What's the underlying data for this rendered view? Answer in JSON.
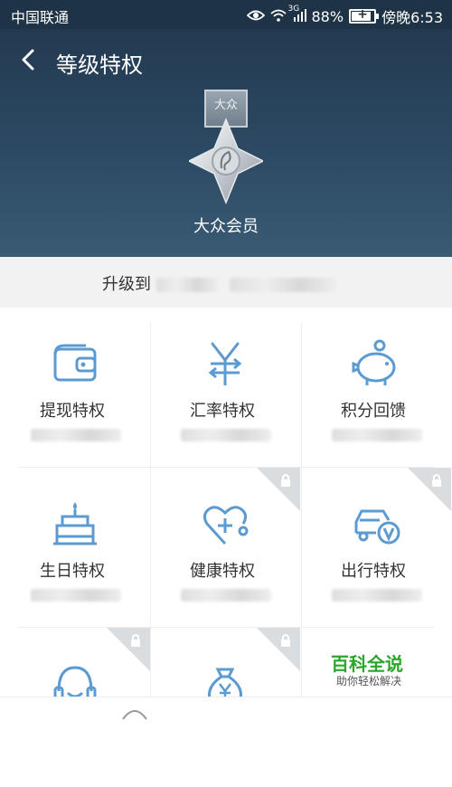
{
  "status_bar": {
    "carrier": "中国联通",
    "network": "3G",
    "battery_percent": "88%",
    "battery_level": 0.88,
    "time": "傍晚6:53"
  },
  "header": {
    "back_icon": "chevron-left-icon",
    "title": "等级特权",
    "medal_ribbon_text": "大众",
    "member_level": "大众会员"
  },
  "banner": {
    "text": "升级到"
  },
  "privileges": [
    {
      "label": "提现特权",
      "icon": "wallet-icon",
      "locked": false
    },
    {
      "label": "汇率特权",
      "icon": "yen-exchange-icon",
      "locked": false
    },
    {
      "label": "积分回馈",
      "icon": "piggy-bank-icon",
      "locked": false
    },
    {
      "label": "生日特权",
      "icon": "birthday-cake-icon",
      "locked": false
    },
    {
      "label": "健康特权",
      "icon": "stethoscope-icon",
      "locked": true
    },
    {
      "label": "出行特权",
      "icon": "car-v-icon",
      "locked": true
    },
    {
      "label": "",
      "icon": "headset-service-icon",
      "locked": true
    },
    {
      "label": "",
      "icon": "money-bag-icon",
      "locked": true
    }
  ],
  "watermark": {
    "title": "百科全说",
    "subtitle": "助你轻松解决"
  },
  "colors": {
    "header_dark": "#233a51",
    "icon_blue": "#5b9bd1",
    "text_dark": "#333333",
    "watermark_green": "#2aa62a"
  }
}
